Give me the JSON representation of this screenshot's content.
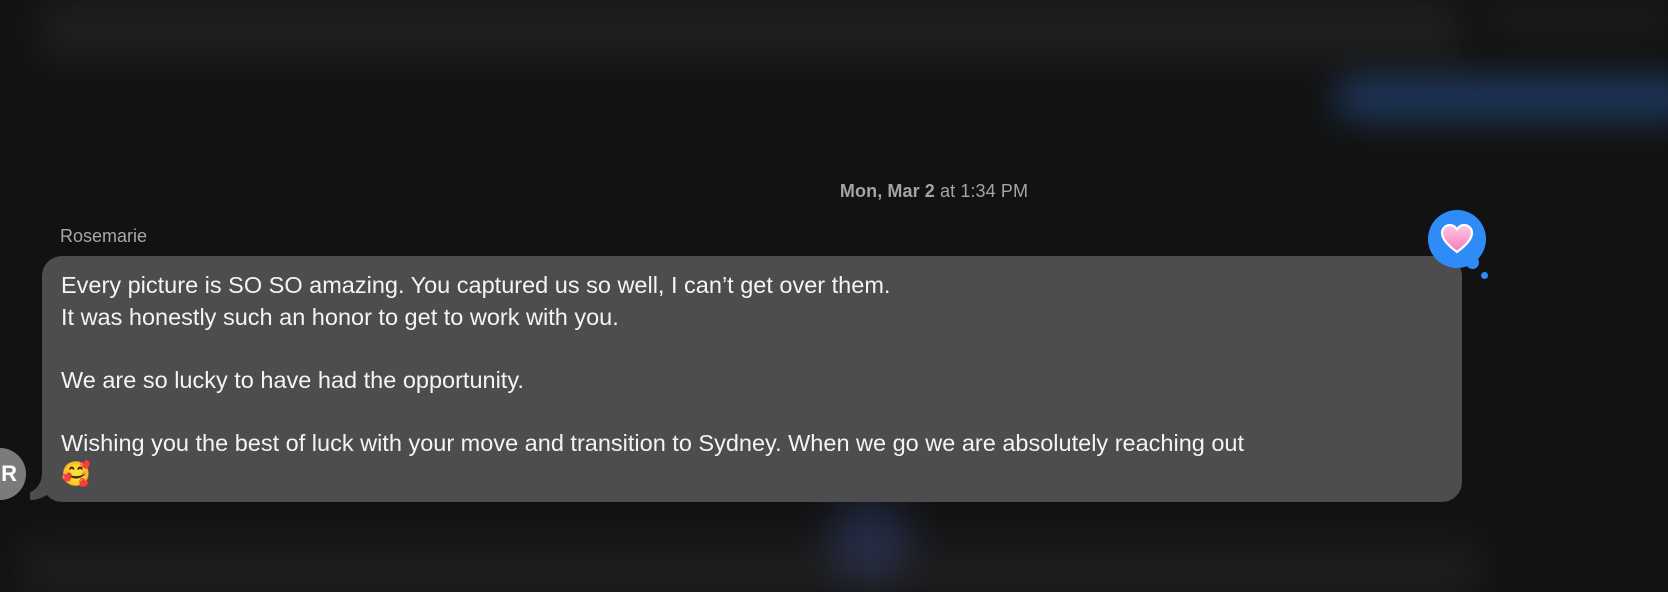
{
  "thread": {
    "timestamp_day": "Mon, Mar 2",
    "timestamp_time": "at 1:34 PM"
  },
  "message": {
    "sender": "Rosemarie",
    "avatar_initial": "R",
    "lines": [
      "Every picture is SO SO amazing. You captured us so well, I can’t get over them.",
      "It was honestly such an honor to get to work with you.",
      "",
      "We are so lucky to have had the opportunity.",
      "",
      "Wishing you the best of luck with your move and transition to Sydney. When we go we are absolutely reaching out"
    ],
    "trailing_emoji": "🥰",
    "emoji_name": "smiling-face-with-hearts-emoji",
    "tapback": {
      "glyph": "🩷",
      "icon": "heart-icon",
      "color": "#2f8cf7"
    },
    "bubble_color": "#4d4d4f"
  }
}
